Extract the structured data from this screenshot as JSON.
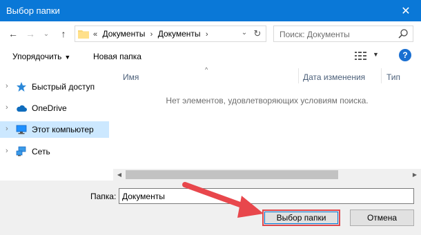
{
  "window": {
    "title": "Выбор папки",
    "close_glyph": "✕"
  },
  "nav": {
    "back_glyph": "←",
    "forward_glyph": "→",
    "recent_glyph": "⌄",
    "up_glyph": "↑",
    "breadcrumb_prefix": "«",
    "breadcrumbs": [
      "Документы",
      "Документы"
    ],
    "breadcrumb_sep": "›",
    "refresh_glyph": "↻",
    "dropdown_glyph": "⌄",
    "search_placeholder": "Поиск: Документы"
  },
  "toolbar": {
    "organize_label": "Упорядочить",
    "organize_caret": "▼",
    "new_folder_label": "Новая папка",
    "view_caret": "▼",
    "help_label": "?"
  },
  "sidebar": {
    "items": [
      {
        "label": "Быстрый доступ",
        "icon": "star-icon"
      },
      {
        "label": "OneDrive",
        "icon": "cloud-icon"
      },
      {
        "label": "Этот компьютер",
        "icon": "computer-icon",
        "selected": true
      },
      {
        "label": "Сеть",
        "icon": "network-icon"
      }
    ],
    "chevron_glyph": "›"
  },
  "content": {
    "columns": [
      "Имя",
      "Дата изменения",
      "Тип"
    ],
    "sort_glyph": "^",
    "empty_message": "Нет элементов, удовлетворяющих условиям поиска.",
    "scroll_left_glyph": "◀",
    "scroll_right_glyph": "▶"
  },
  "footer": {
    "folder_label": "Папка:",
    "folder_value": "Документы",
    "select_button": "Выбор папки",
    "cancel_button": "Отмена"
  },
  "colors": {
    "titlebar": "#0a78d7",
    "selection": "#cce8ff",
    "annotation_red": "#e0474c"
  }
}
